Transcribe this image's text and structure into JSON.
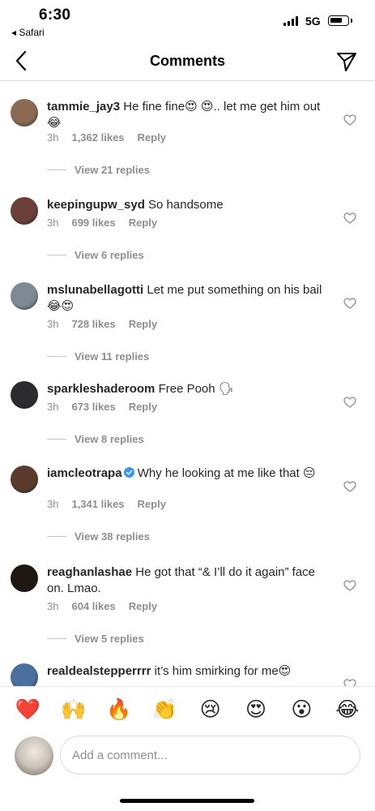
{
  "status_bar": {
    "time": "6:30",
    "back_app": "◂ Safari",
    "network": "5G"
  },
  "nav": {
    "title": "Comments"
  },
  "comments": [
    {
      "username": "tammie_jay3",
      "text": "He fine fine😍 😍.. let me get him out😂",
      "time": "3h",
      "likes": "1,362 likes",
      "reply": "Reply",
      "view_replies": "View 21 replies",
      "avatar_color": "#8a6a50"
    },
    {
      "username": "keepingupw_syd",
      "text": "So handsome",
      "time": "3h",
      "likes": "699 likes",
      "reply": "Reply",
      "view_replies": "View 6 replies",
      "avatar_color": "#6b3f3a"
    },
    {
      "username": "mslunabellagotti",
      "text": "Let me put something on his bail 😂😍",
      "time": "3h",
      "likes": "728 likes",
      "reply": "Reply",
      "view_replies": "View 11 replies",
      "avatar_color": "#7d8a94"
    },
    {
      "username": "sparkleshaderoom",
      "text": "Free Pooh 🗣",
      "time": "3h",
      "likes": "673 likes",
      "reply": "Reply",
      "view_replies": "View 8 replies",
      "avatar_color": "#2c2c30"
    },
    {
      "username": "iamcleotrapa",
      "verified": true,
      "text": "Why he looking at me like that 😔",
      "time": "3h",
      "likes": "1,341 likes",
      "reply": "Reply",
      "view_replies": "View 38 replies",
      "avatar_color": "#5a3b2c"
    },
    {
      "username": "reaghanlashae",
      "text": "He got that “& I’ll do it again” face on. Lmao.",
      "time": "3h",
      "likes": "604 likes",
      "reply": "Reply",
      "view_replies": "View 5 replies",
      "avatar_color": "#1e1712"
    },
    {
      "username": "realdealstepperrrr",
      "text": "it’s him smirking for me😍",
      "avatar_color": "#4b6f9e"
    }
  ],
  "reactions": [
    "❤️",
    "🙌",
    "🔥",
    "👏",
    "😢",
    "😍",
    "😮",
    "😂"
  ],
  "composer": {
    "placeholder": "Add a comment...",
    "avatar_color": "#c9c2b8"
  },
  "colors": {
    "verified": "#3897f0",
    "muted": "#8e8e8e"
  }
}
